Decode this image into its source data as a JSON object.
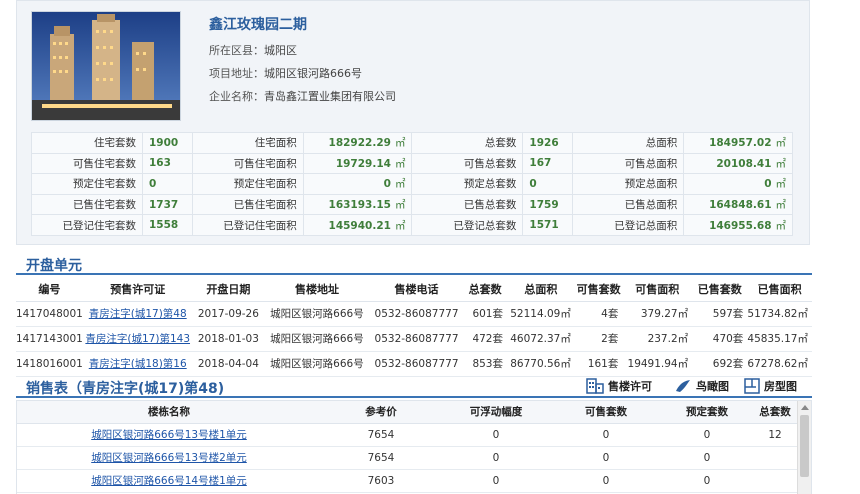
{
  "project": {
    "name": "鑫江玫瑰园二期",
    "district_label": "所在区县：",
    "district": "城阳区",
    "address_label": "项目地址：",
    "address": "城阳区银河路666号",
    "company_label": "企业名称：",
    "company": "青岛鑫江置业集团有限公司"
  },
  "stats": [
    [
      {
        "label": "住宅套数",
        "value": "1900"
      },
      {
        "label": "住宅面积",
        "value": "182922.29",
        "unit": "㎡"
      },
      {
        "label": "总套数",
        "value": "1926"
      },
      {
        "label": "总面积",
        "value": "184957.02",
        "unit": "㎡"
      }
    ],
    [
      {
        "label": "可售住宅套数",
        "value": "163"
      },
      {
        "label": "可售住宅面积",
        "value": "19729.14",
        "unit": "㎡"
      },
      {
        "label": "可售总套数",
        "value": "167"
      },
      {
        "label": "可售总面积",
        "value": "20108.41",
        "unit": "㎡"
      }
    ],
    [
      {
        "label": "预定住宅套数",
        "value": "0"
      },
      {
        "label": "预定住宅面积",
        "value": "0",
        "unit": "㎡"
      },
      {
        "label": "预定总套数",
        "value": "0"
      },
      {
        "label": "预定总面积",
        "value": "0",
        "unit": "㎡"
      }
    ],
    [
      {
        "label": "已售住宅套数",
        "value": "1737"
      },
      {
        "label": "已售住宅面积",
        "value": "163193.15",
        "unit": "㎡"
      },
      {
        "label": "已售总套数",
        "value": "1759"
      },
      {
        "label": "已售总面积",
        "value": "164848.61",
        "unit": "㎡"
      }
    ],
    [
      {
        "label": "已登记住宅套数",
        "value": "1558"
      },
      {
        "label": "已登记住宅面积",
        "value": "145940.21",
        "unit": "㎡"
      },
      {
        "label": "已登记总套数",
        "value": "1571"
      },
      {
        "label": "已登记总面积",
        "value": "146955.68",
        "unit": "㎡"
      }
    ]
  ],
  "opening": {
    "title": "开盘单元",
    "columns": [
      "编号",
      "预售许可证",
      "开盘日期",
      "售楼地址",
      "售楼电话",
      "总套数",
      "总面积",
      "可售套数",
      "可售面积",
      "已售套数",
      "已售面积"
    ],
    "rows": [
      [
        "1417048001",
        "青房注字(城17)第48",
        "2017-09-26",
        "城阳区银河路666号",
        "0532-86087777",
        "601套",
        "52114.09㎡",
        "4套",
        "379.27㎡",
        "597套",
        "51734.82㎡"
      ],
      [
        "1417143001",
        "青房注字(城17)第143",
        "2018-01-03",
        "城阳区银河路666号",
        "0532-86087777",
        "472套",
        "46072.37㎡",
        "2套",
        "237.2㎡",
        "470套",
        "45835.17㎡"
      ],
      [
        "1418016001",
        "青房注字(城18)第16",
        "2018-04-04",
        "城阳区银河路666号",
        "0532-86087777",
        "853套",
        "86770.56㎡",
        "161套",
        "19491.94㎡",
        "692套",
        "67278.62㎡"
      ]
    ]
  },
  "sales": {
    "title": "销售表（青房注字(城17)第48)",
    "tools": {
      "permit": "售楼许可",
      "aerial": "鸟瞰图",
      "floorplan": "房型图"
    },
    "columns": [
      "楼栋名称",
      "参考价",
      "可浮动幅度",
      "可售套数",
      "预定套数",
      "总套数"
    ],
    "rows": [
      [
        "城阳区银河路666号13号楼1单元",
        "7654",
        "0",
        "0",
        "0",
        "12"
      ],
      [
        "城阳区银河路666号13号楼2单元",
        "7654",
        "0",
        "0",
        "0",
        ""
      ],
      [
        "城阳区银河路666号14号楼1单元",
        "7603",
        "0",
        "0",
        "0",
        ""
      ]
    ]
  },
  "colors": {
    "accent": "#2c5f9e",
    "value_green": "#3f7e3a",
    "link": "#1e55a8"
  }
}
